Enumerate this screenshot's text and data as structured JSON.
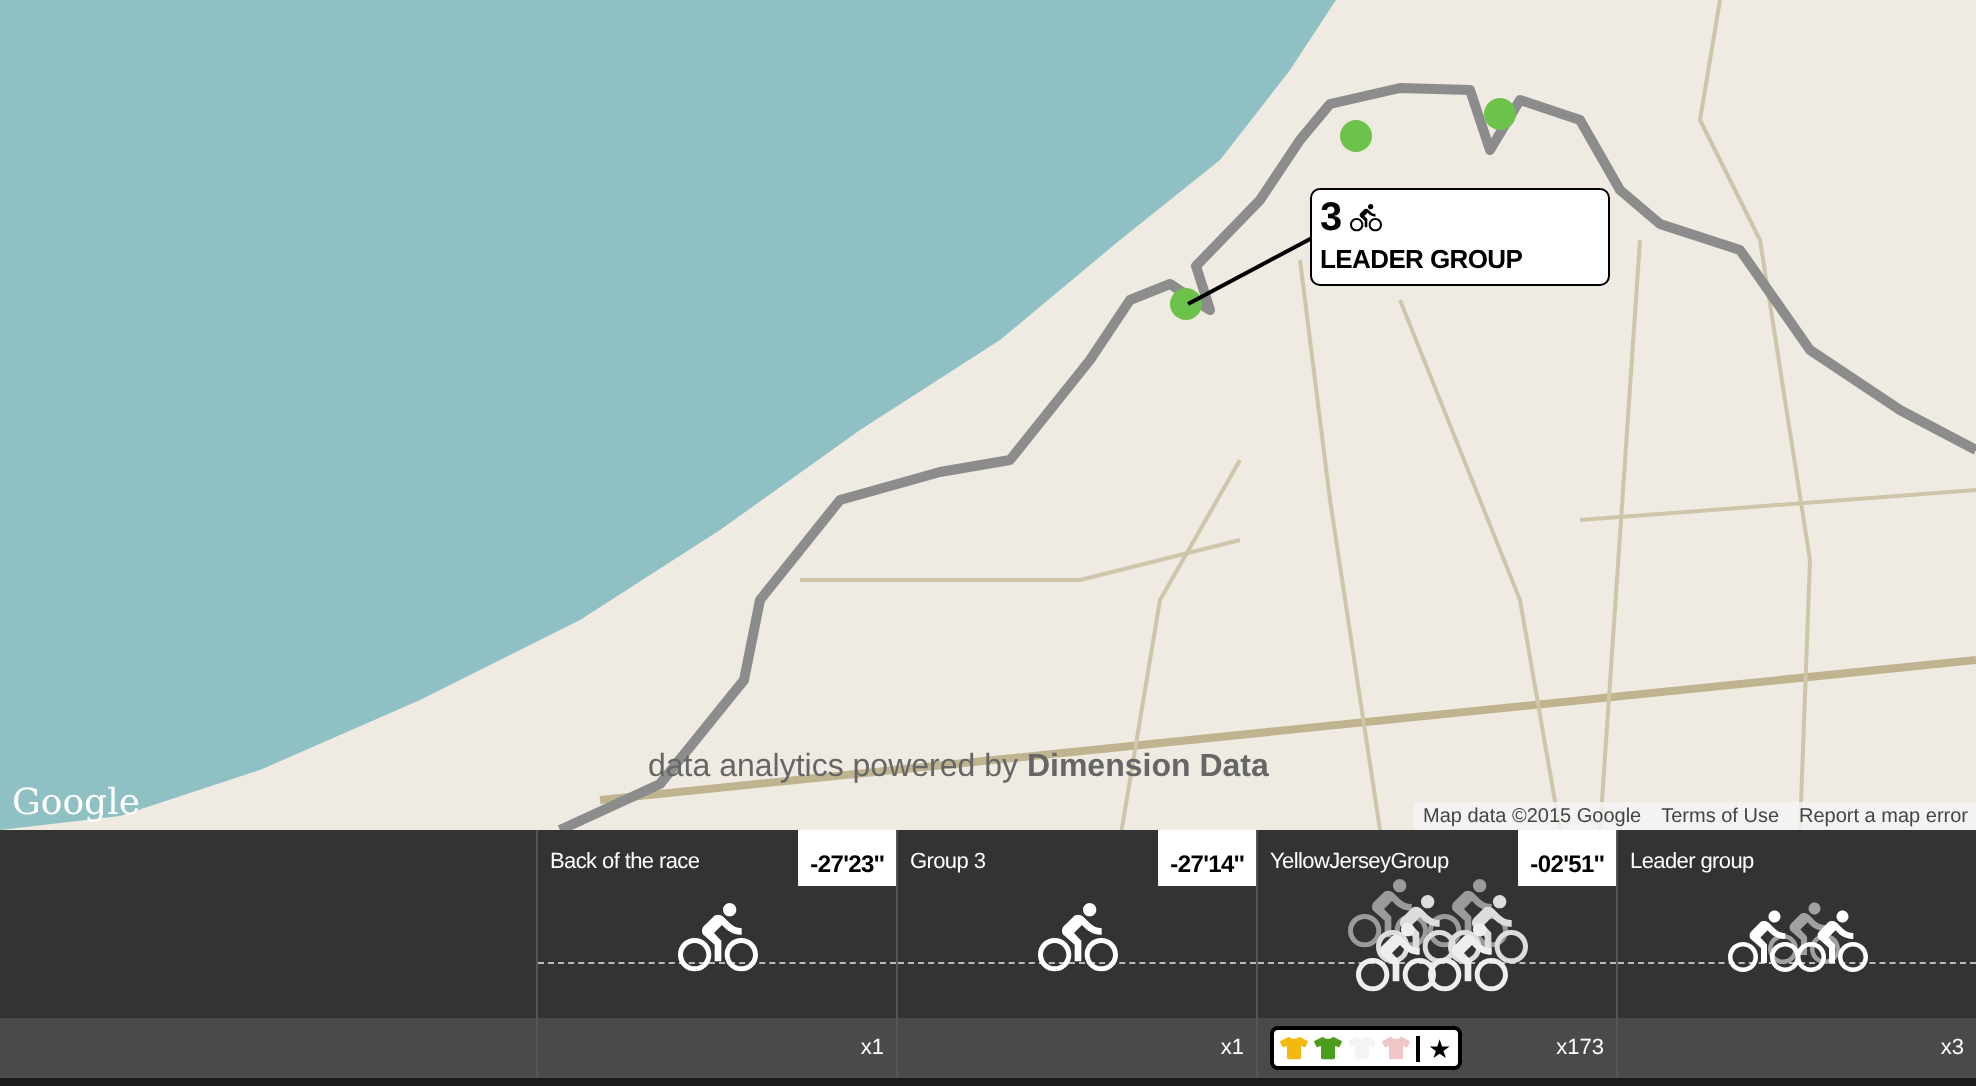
{
  "map": {
    "callout": {
      "number": "3",
      "title": "LEADER GROUP"
    },
    "branding": {
      "logo": "Google",
      "credit": "data analytics powered by **Dimension Data**"
    },
    "attribution": [
      "Map data ©2015 Google",
      "Terms of Use",
      "Report a map error"
    ]
  },
  "groups": [
    {
      "name": "Back of the race",
      "gap": "-27'23''",
      "count": "x1",
      "kind": "single"
    },
    {
      "name": "Group 3",
      "gap": "-27'14''",
      "count": "x1",
      "kind": "single"
    },
    {
      "name": "YellowJerseyGroup",
      "gap": "-02'51''",
      "count": "x173",
      "kind": "peloton",
      "jerseys": [
        {
          "color": "#f2b90f"
        },
        {
          "color": "#4a9e1c"
        },
        {
          "color": "#f4f4f4"
        },
        {
          "color": "#f2c7c7"
        }
      ],
      "star": "★"
    },
    {
      "name": "Leader group",
      "count": "x3",
      "kind": "trio"
    }
  ]
}
